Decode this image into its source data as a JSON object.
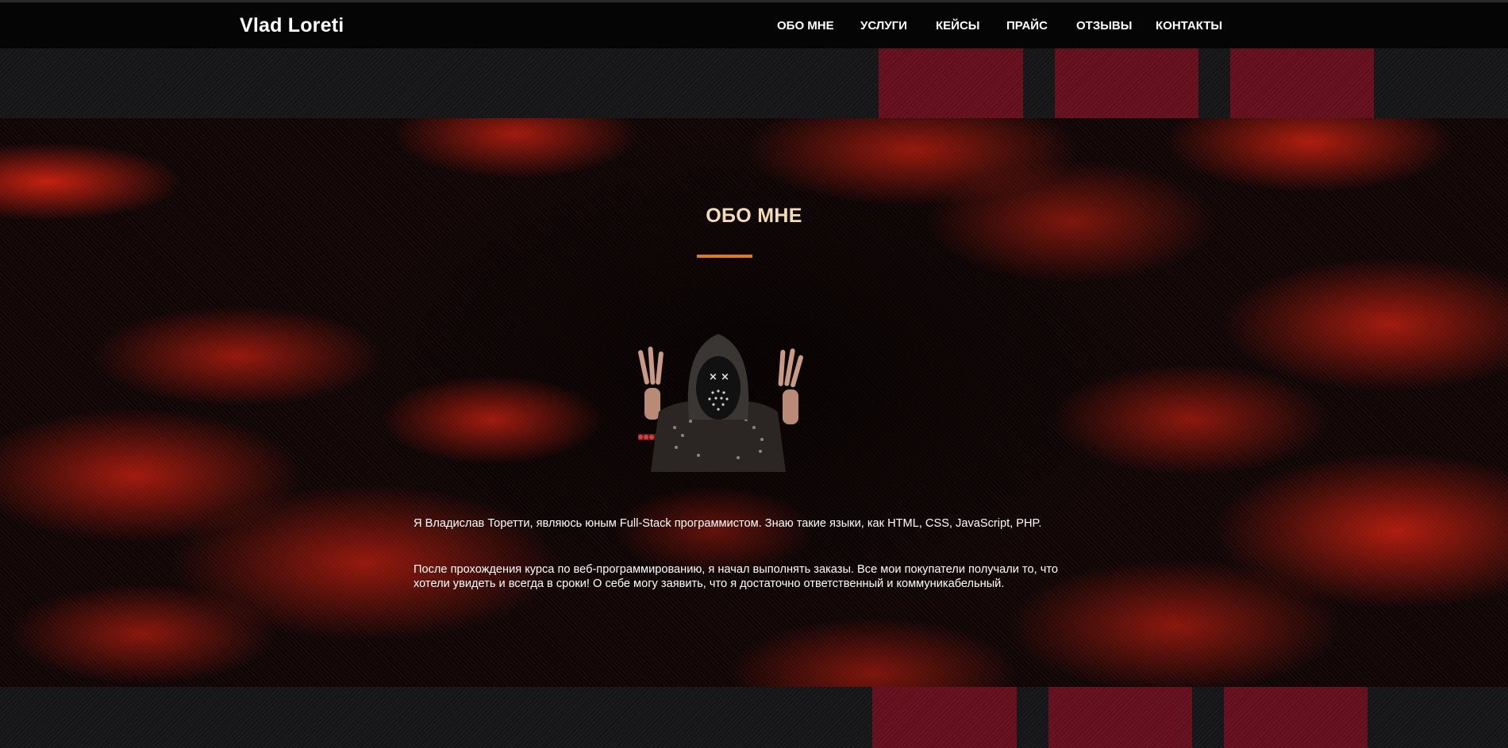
{
  "header": {
    "logo": "Vlad Loreti",
    "menu": [
      {
        "label": "ОБО МНЕ"
      },
      {
        "label": "УСЛУГИ"
      },
      {
        "label": "КЕЙСЫ"
      },
      {
        "label": "ПРАЙС"
      },
      {
        "label": "ОТЗЫВЫ"
      },
      {
        "label": "КОНТАКТЫ"
      }
    ]
  },
  "about": {
    "title": "ОБО МНЕ",
    "paragraph_1": "Я Владислав Торетти, являюсь юным Full-Stack программистом. Знаю такие языки, как HTML, CSS, JavaScript, PHP.",
    "paragraph_2": "После прохождения курса по веб-программированию, я начал выполнять заказы. Все мои покупатели получали то, что хотели увидеть и всегда в сроки! О себе могу заявить, что я достаточно ответственный и коммуникабельный."
  },
  "colors": {
    "accent": "#e07a1f",
    "title": "#f4dcb4",
    "stripe_red": "#6d1322",
    "hero_red": "#ff2814"
  }
}
